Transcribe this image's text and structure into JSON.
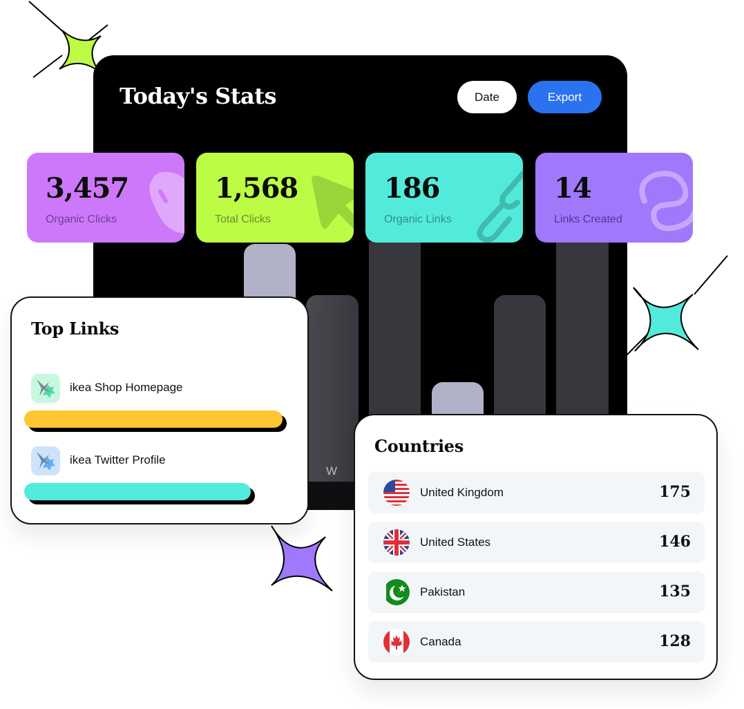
{
  "header": {
    "title": "Today's Stats",
    "date_label": "Date",
    "export_label": "Export"
  },
  "colors": {
    "accent_blue": "#2b72f0",
    "lime": "#bdfc45",
    "teal": "#52ebdb",
    "purple": "#a078fb",
    "magenta": "#cd78fa",
    "yellow": "#fec630",
    "bar_light": "#b1b1c8",
    "bar_dark": "#38373d"
  },
  "stats": [
    {
      "value": "3,457",
      "label": "Organic Clicks",
      "icon": "mouse-icon",
      "color": "#cd78fa"
    },
    {
      "value": "1,568",
      "label": "Total Clicks",
      "icon": "cursor-arrow-icon",
      "color": "#bdfc45"
    },
    {
      "value": "186",
      "label": "Organic Links",
      "icon": "chain-link-icon",
      "color": "#52ebdb"
    },
    {
      "value": "14",
      "label": "Links Created",
      "icon": "loop-link-icon",
      "color": "#a078fb"
    }
  ],
  "chart": {
    "visible_axis_label": "W"
  },
  "top_links": {
    "title": "Top Links",
    "items": [
      {
        "name": "ikea Shop Homepage",
        "icon": "sparkle-star-icon",
        "progress": 0.9,
        "bar_color": "#fec630",
        "icon_bg": "#c8f7e0"
      },
      {
        "name": "ikea Twitter Profile",
        "icon": "sparkle-star-icon",
        "progress": 0.79,
        "bar_color": "#52ebdb",
        "icon_bg": "#cde3fb"
      }
    ]
  },
  "countries": {
    "title": "Countries",
    "items": [
      {
        "name": "United Kingdom",
        "count": "175",
        "flag": "us-flag-icon"
      },
      {
        "name": "United States",
        "count": "146",
        "flag": "uk-flag-icon"
      },
      {
        "name": "Pakistan",
        "count": "135",
        "flag": "pakistan-flag-icon"
      },
      {
        "name": "Canada",
        "count": "128",
        "flag": "canada-flag-icon"
      }
    ]
  }
}
